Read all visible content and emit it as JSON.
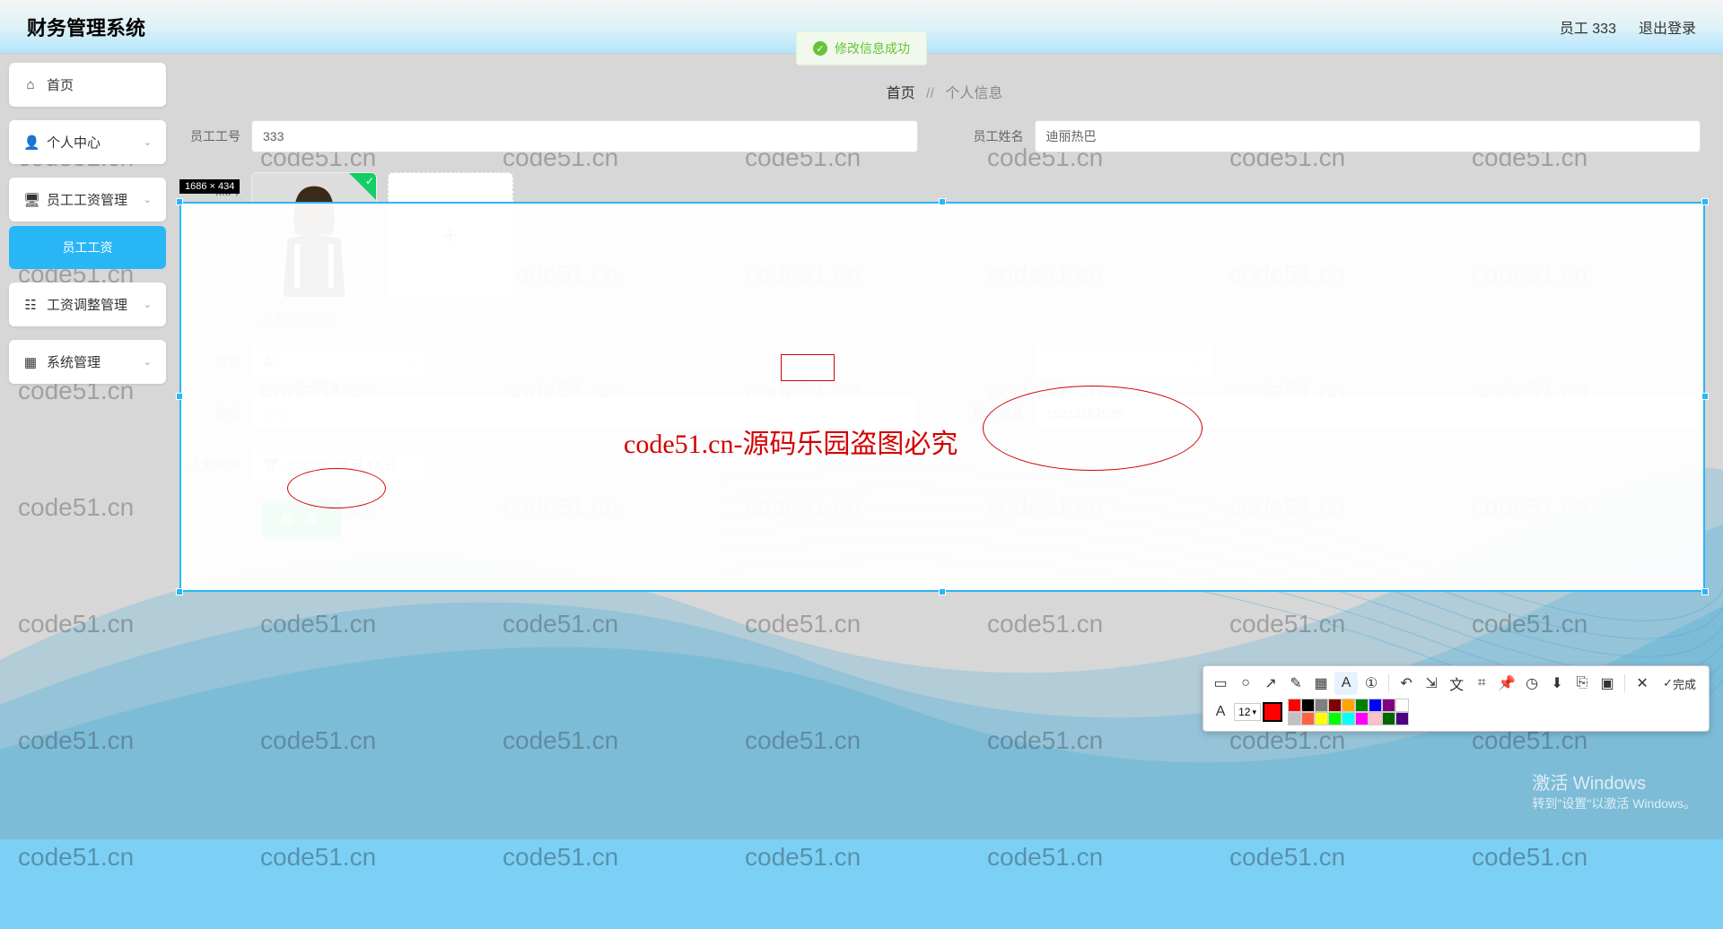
{
  "header": {
    "title": "财务管理系统",
    "user_label": "员工 333",
    "logout": "退出登录"
  },
  "toast": {
    "text": "修改信息成功"
  },
  "sidebar": {
    "home": "首页",
    "personal": "个人中心",
    "salary": "员工工资管理",
    "salary_sub": "员工工资",
    "adjust": "工资调整管理",
    "system": "系统管理"
  },
  "breadcrumb": {
    "home": "首页",
    "sep": "//",
    "current": "个人信息"
  },
  "form": {
    "emp_id_label": "员工工号",
    "emp_id_value": "333",
    "emp_name_label": "员工姓名",
    "emp_name_value": "迪丽热巴",
    "photo_label": "照片",
    "photo_hint": "点击上传照片",
    "gender_label": "性别",
    "gender_value": "女",
    "position_label": "职位",
    "position_placeholder": "职位",
    "contact_label": "联系方式",
    "contact_value": "15219187575",
    "hire_date_label": "入职时间",
    "hire_date_value": "2022 年 04 月 14 日",
    "submit": "修 改"
  },
  "selection": {
    "dim_label": "1686 × 434"
  },
  "annotations": {
    "watermark_text": "code51.cn",
    "overlay_text": "code51.cn-源码乐园盗图必究"
  },
  "win": {
    "line1": "激活 Windows",
    "line2": "转到\"设置\"以激活 Windows。"
  },
  "toolbar": {
    "a_label": "A",
    "size": "12",
    "done": "完成",
    "colors": [
      "#ff0000",
      "#000000",
      "#808080",
      "#800000",
      "#ffa500",
      "#008000",
      "#0000ff",
      "#800080",
      "#ffffff",
      "#c0c0c0",
      "#ff6347",
      "#ffff00",
      "#00ff00",
      "#00ffff",
      "#ff00ff",
      "#ffc0cb",
      "#006400",
      "#4b0082"
    ]
  }
}
